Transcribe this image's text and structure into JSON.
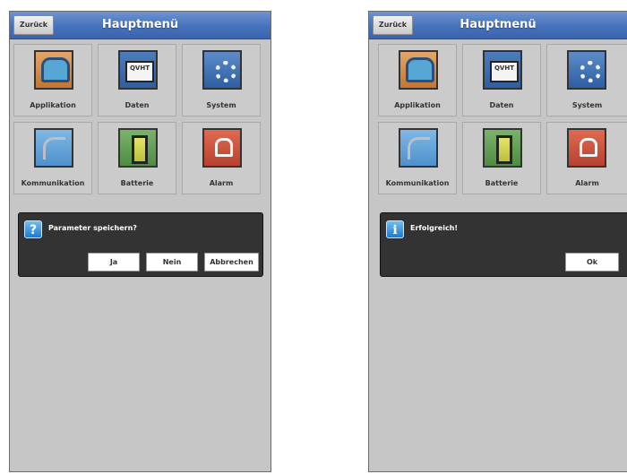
{
  "left_screen": {
    "back_label": "Zurück",
    "title": "Hauptmenü",
    "tiles": [
      {
        "label": "Applikation",
        "icon": "applikation-icon"
      },
      {
        "label": "Daten",
        "icon": "daten-icon"
      },
      {
        "label": "System",
        "icon": "system-icon"
      },
      {
        "label": "Kommunikation",
        "icon": "kommunikation-icon"
      },
      {
        "label": "Batterie",
        "icon": "batterie-icon"
      },
      {
        "label": "Alarm",
        "icon": "alarm-icon"
      }
    ],
    "dialog": {
      "icon": "question-icon",
      "icon_glyph": "?",
      "message": "Parameter speichern?",
      "buttons": [
        "Ja",
        "Nein",
        "Abbrechen"
      ]
    }
  },
  "right_screen": {
    "back_label": "Zurück",
    "title": "Hauptmenü",
    "tiles": [
      {
        "label": "Applikation",
        "icon": "applikation-icon"
      },
      {
        "label": "Daten",
        "icon": "daten-icon"
      },
      {
        "label": "System",
        "icon": "system-icon"
      },
      {
        "label": "Kommunikation",
        "icon": "kommunikation-icon"
      },
      {
        "label": "Batterie",
        "icon": "batterie-icon"
      },
      {
        "label": "Alarm",
        "icon": "alarm-icon"
      }
    ],
    "dialog": {
      "icon": "info-icon",
      "icon_glyph": "i",
      "message": "Erfolgreich!",
      "buttons": [
        "Ok"
      ]
    }
  },
  "colors": {
    "titlebar": "#4672bd",
    "screen_bg": "#c6c6c6",
    "dialog_bg": "#333333"
  }
}
